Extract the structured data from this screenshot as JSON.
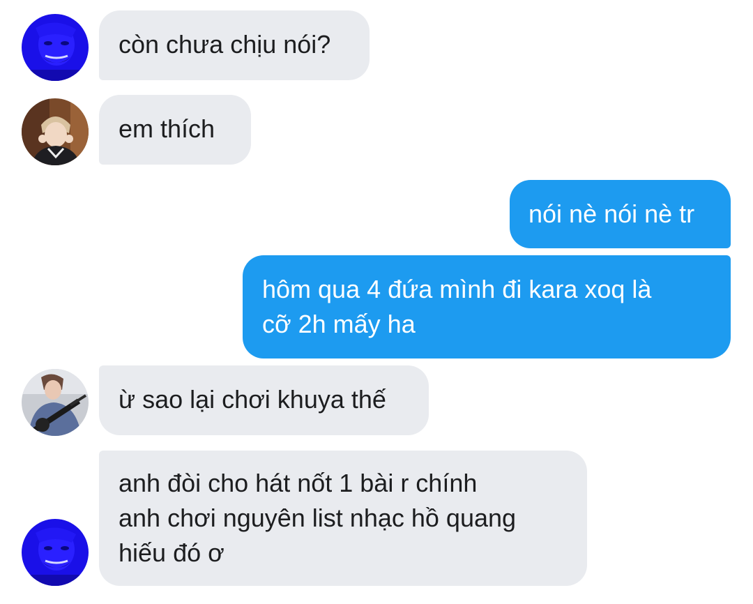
{
  "conversation": {
    "messages": [
      {
        "sender": "incoming",
        "avatar_icon": "blue-avatar-icon",
        "text": "còn chưa chịu nói?"
      },
      {
        "sender": "incoming",
        "avatar_icon": "person-photo-avatar-icon",
        "text": "em thích"
      },
      {
        "sender": "outgoing",
        "text": "nói nè nói nè tr"
      },
      {
        "sender": "outgoing",
        "lines": [
          "hôm qua 4 đứa mình đi kara xoq là",
          "cỡ 2h mấy ha"
        ]
      },
      {
        "sender": "incoming",
        "avatar_icon": "guitar-photo-avatar-icon",
        "text": "ừ sao lại chơi khuya thế"
      },
      {
        "sender": "incoming",
        "avatar_icon": "blue-avatar-icon",
        "lines": [
          "anh đòi cho hát nốt 1 bài r chính",
          "anh chơi nguyên list nhạc hồ quang",
          "hiếu đó ơ"
        ]
      }
    ]
  },
  "colors": {
    "incoming_bubble": "#e9ebef",
    "outgoing_bubble": "#1d9bf0",
    "incoming_text": "#1c1d1f",
    "outgoing_text": "#ffffff"
  }
}
